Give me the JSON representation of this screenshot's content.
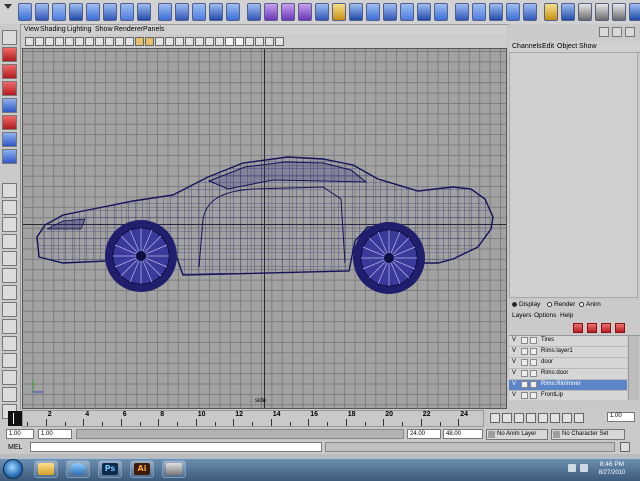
{
  "viewport": {
    "menu": [
      "View",
      "Shading",
      "Lighting",
      "Show",
      "Renderer",
      "Panels"
    ],
    "camera_label": "side",
    "colors": {
      "background": "#a2a2a2",
      "grid": "#7e7e7e",
      "wireframe": "#1c1c78"
    }
  },
  "channel_box": {
    "menu": [
      "Channels",
      "Edit",
      "Object",
      "Show"
    ]
  },
  "layer_editor": {
    "modes": [
      "Display",
      "Render",
      "Anim"
    ],
    "active_mode": "Display",
    "menu": [
      "Layers",
      "Options",
      "Help"
    ],
    "layers": [
      {
        "visible": "V",
        "name": "Tires",
        "selected": false
      },
      {
        "visible": "V",
        "name": "Rims:layer1",
        "selected": false
      },
      {
        "visible": "V",
        "name": "door",
        "selected": false
      },
      {
        "visible": "V",
        "name": "Rims:door",
        "selected": false
      },
      {
        "visible": "V",
        "name": "Rims:RimInner",
        "selected": true
      },
      {
        "visible": "V",
        "name": "FrontLip",
        "selected": false
      }
    ],
    "accent": "#5b85c7"
  },
  "time_slider": {
    "current_frame": "1",
    "tick_labels": [
      "2",
      "4",
      "6",
      "8",
      "10",
      "12",
      "14",
      "16",
      "18",
      "20",
      "22",
      "24"
    ],
    "frame_field": "1.00",
    "range_start": "1.00",
    "range_start_inner": "1.00",
    "range_end_inner": "24.00",
    "range_end": "48.00",
    "anim_layer": "No Anim Layer",
    "character_set": "No Character Set"
  },
  "command_line": {
    "label": "MEL"
  },
  "taskbar": {
    "apps": [
      {
        "name": "explorer",
        "glyph": ""
      },
      {
        "name": "media-player",
        "glyph": ""
      },
      {
        "name": "photoshop",
        "glyph": "Ps"
      },
      {
        "name": "illustrator",
        "glyph": "Ai"
      },
      {
        "name": "maya",
        "glyph": ""
      }
    ],
    "time": "8:46 PM",
    "date": "8/27/2010"
  }
}
